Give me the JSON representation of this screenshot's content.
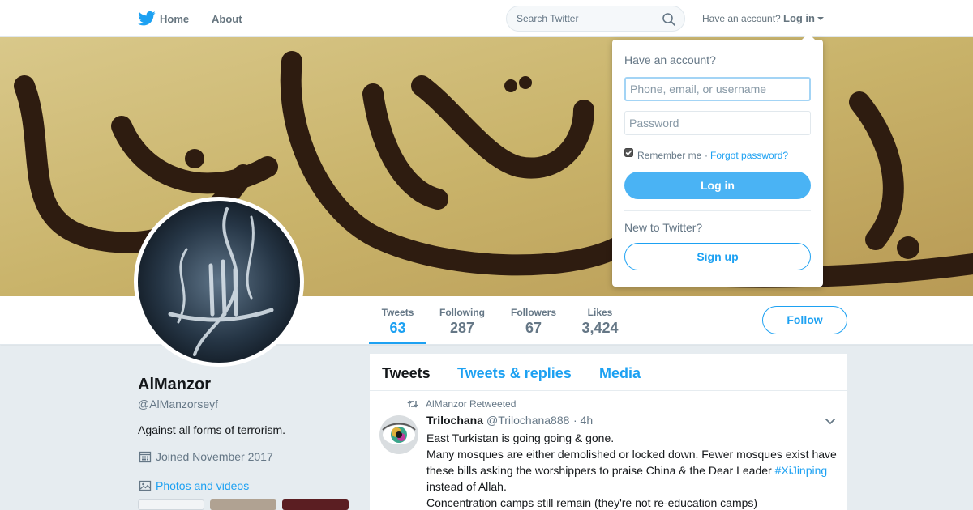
{
  "topnav": {
    "home_label": "Home",
    "about_label": "About",
    "search_placeholder": "Search Twitter",
    "have_account": "Have an account?",
    "login_label": "Log in"
  },
  "profile": {
    "name": "AlManzor",
    "handle": "@AlManzorseyf",
    "bio": "Against all forms of terrorism.",
    "joined": "Joined November 2017",
    "photos_label": "Photos and videos"
  },
  "stats": [
    {
      "label": "Tweets",
      "value": "63"
    },
    {
      "label": "Following",
      "value": "287"
    },
    {
      "label": "Followers",
      "value": "67"
    },
    {
      "label": "Likes",
      "value": "3,424"
    }
  ],
  "follow_label": "Follow",
  "tabs": [
    "Tweets",
    "Tweets & replies",
    "Media"
  ],
  "tweet": {
    "retweet_label": "AlManzor Retweeted",
    "author_name": "Trilochana",
    "author_handle": "@Trilochana888",
    "time": "· 4h",
    "lines": [
      "East Turkistan is going going & gone.",
      "Many mosques are either demolished or locked down. Fewer mosques exist have",
      "these bills asking the worshippers to praise China & the Dear Leader",
      "instead of Allah.",
      "Concentration camps still remain (they're not re-education camps)"
    ],
    "hashtag": "#XiJinping"
  },
  "login_dropdown": {
    "heading": "Have an account?",
    "username_placeholder": "Phone, email, or username",
    "password_placeholder": "Password",
    "remember": "Remember me",
    "separator": "·",
    "forgot": "Forgot password?",
    "login_button": "Log in",
    "new_heading": "New to Twitter?",
    "signup_button": "Sign up"
  },
  "colors": {
    "accent": "#1da1f2",
    "login_button": "#4ab3f4",
    "background": "#e6ecf0"
  }
}
